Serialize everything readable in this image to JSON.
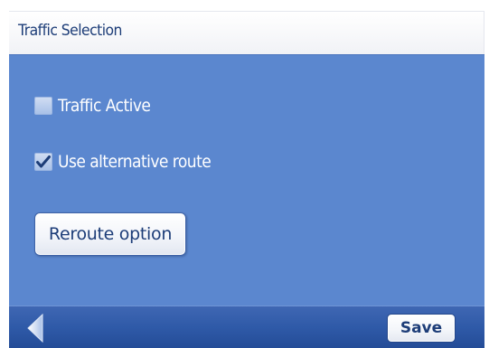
{
  "header": {
    "title": "Traffic Selection"
  },
  "options": [
    {
      "label": "Traffic Active",
      "checked": false
    },
    {
      "label": "Use alternative route",
      "checked": true
    }
  ],
  "reroute": {
    "label": "Reroute option"
  },
  "footer": {
    "back_icon": "back-arrow-icon",
    "save_label": "Save"
  },
  "colors": {
    "header_text": "#1d3d78",
    "panel_background": "#5b87cf",
    "bottom_bar": "#2f5aa8",
    "checkbox_fill": "#b9cdee",
    "checkmark": "#1d3d78"
  }
}
